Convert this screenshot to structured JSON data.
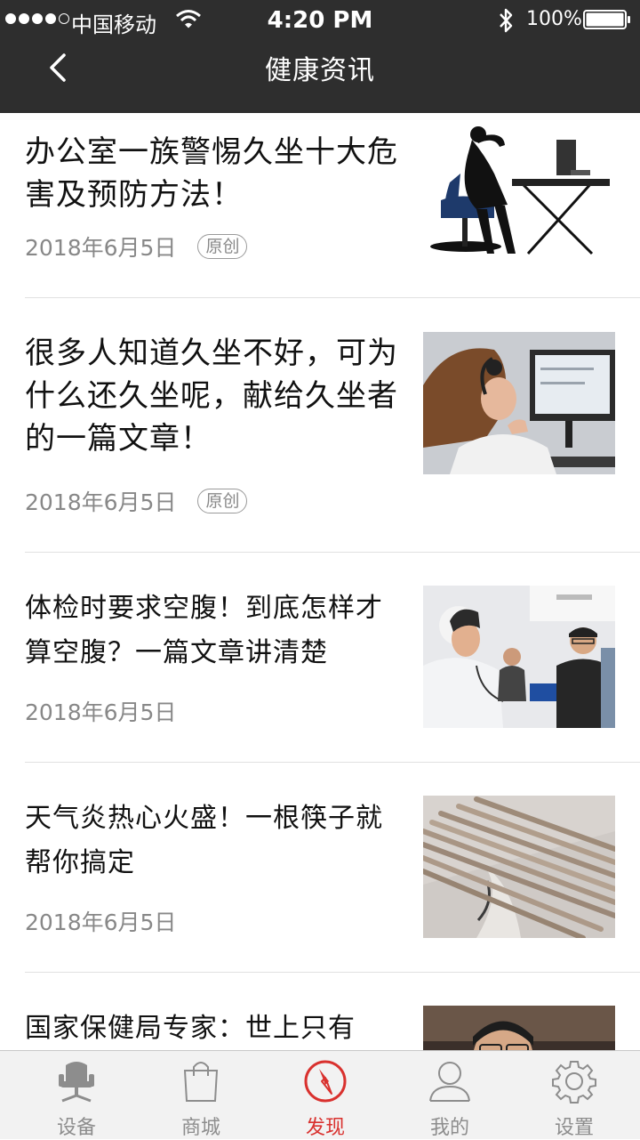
{
  "status_bar": {
    "carrier": "中国移动",
    "time": "4:20 PM",
    "battery": "100%"
  },
  "nav": {
    "title": "健康资讯"
  },
  "articles": [
    {
      "title": "办公室一族警惕久坐十大危害及预防方法！",
      "date": "2018年6月5日",
      "tag": "原创",
      "image": "office-chair-back-pain-photo"
    },
    {
      "title": "很多人知道久坐不好，可为什么还久坐呢，献给久坐者的一篇文章！",
      "date": "2018年6月5日",
      "tag": "原创",
      "image": "woman-neck-pain-computer-photo"
    },
    {
      "title": "体检时要求空腹！到底怎样才算空腹？一篇文章讲清楚",
      "date": "2018年6月5日",
      "tag": "",
      "image": "nurse-blood-pressure-exam-photo"
    },
    {
      "title": "天气炎热心火盛！一根筷子就帮你搞定",
      "date": "2018年6月5日",
      "tag": "",
      "image": "chopsticks-photo"
    },
    {
      "title": "国家保健局专家：世上只有",
      "date": "",
      "tag": "",
      "image": "expert-portrait-photo"
    }
  ],
  "tabbar": {
    "tabs": [
      {
        "label": "设备",
        "icon": "chair-icon",
        "active": false
      },
      {
        "label": "商城",
        "icon": "shopping-bag-icon",
        "active": false
      },
      {
        "label": "发现",
        "icon": "compass-icon",
        "active": true
      },
      {
        "label": "我的",
        "icon": "user-icon",
        "active": false
      },
      {
        "label": "设置",
        "icon": "gear-icon",
        "active": false
      }
    ]
  },
  "colors": {
    "header_bg": "#2e2e2e",
    "accent": "#d9312e",
    "tab_inactive": "#8d8d8d",
    "meta_text": "#888888"
  }
}
